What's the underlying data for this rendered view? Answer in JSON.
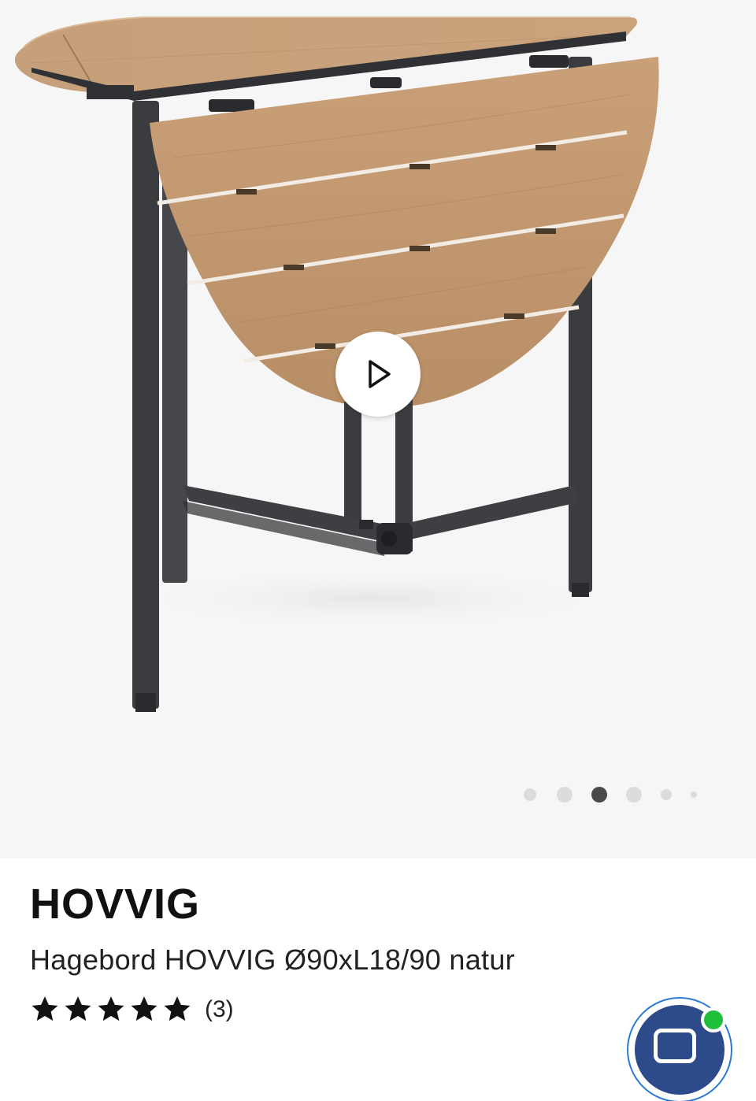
{
  "gallery": {
    "image": "product-photo-folding-garden-table",
    "play_icon": "play-icon",
    "slide_count": 6,
    "active_slide": 3
  },
  "product": {
    "brand": "HOVVIG",
    "subtitle": "Hagebord HOVVIG Ø90xL18/90 natur",
    "rating": 5,
    "rating_max": 5,
    "review_count": "(3)"
  },
  "chat": {
    "icon": "chat-icon",
    "status_color": "#1fbf3a",
    "fab_color": "#2d4a8a"
  }
}
